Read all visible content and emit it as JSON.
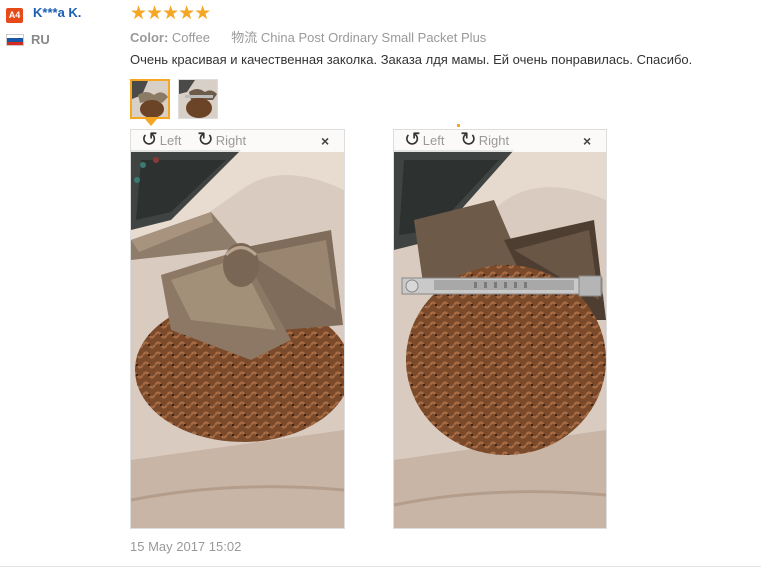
{
  "user": {
    "badge": "A4",
    "name": "K***a K.",
    "country": "RU"
  },
  "review": {
    "rating_stars": "★★★★★",
    "rating": 5,
    "color_label": "Color:",
    "color_value": "Coffee",
    "shipping_label": "物流",
    "shipping_value": "China Post Ordinary Small Packet Plus",
    "text": "Очень красивая и качественная заколка. Заказа лдя мамы. Ей очень понравилась. Спасибо.",
    "date": "15 May 2017 15:02"
  },
  "viewer": {
    "rotate_left": "Left",
    "rotate_right": "Right",
    "close": "×"
  },
  "colors": {
    "accent": "#f5a623",
    "username": "#1a5fb4",
    "badge": "#e64a19"
  }
}
